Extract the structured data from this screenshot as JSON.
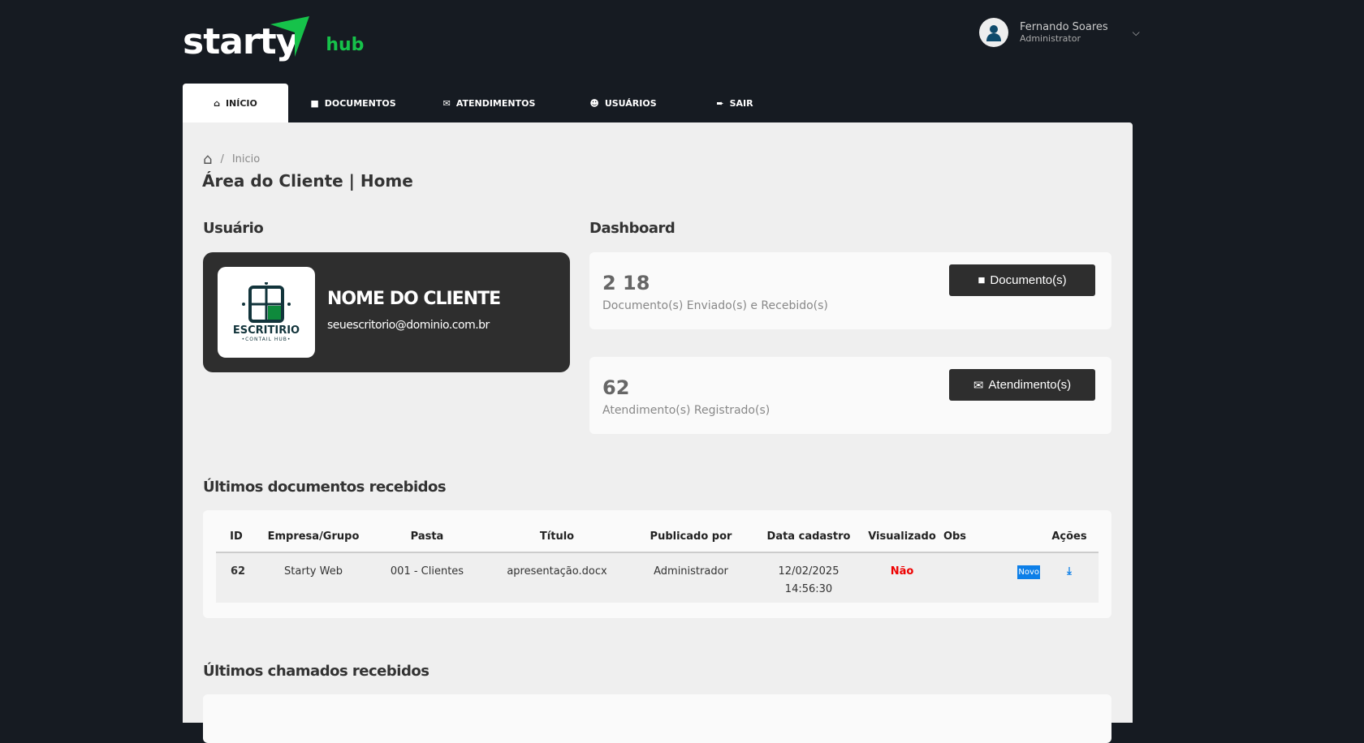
{
  "brand": {
    "logo_text": "starty",
    "logo_suffix": "hub"
  },
  "user": {
    "name": "Fernando Soares",
    "role": "Administrator"
  },
  "nav": [
    {
      "label": "INÍCIO",
      "icon": "home-icon"
    },
    {
      "label": "DOCUMENTOS",
      "icon": "folder-icon"
    },
    {
      "label": "ATENDIMENTOS",
      "icon": "envelope-icon"
    },
    {
      "label": "USUÁRIOS",
      "icon": "users-icon"
    },
    {
      "label": "SAIR",
      "icon": "sign-out-icon"
    }
  ],
  "breadcrumb": {
    "current": "Inicio"
  },
  "page_title": "Área do Cliente | Home",
  "usuario": {
    "heading": "Usuário",
    "client_name": "NOME DO CLIENTE",
    "email": "seuescritorio@dominio.com.br",
    "logo_title": "ESCRITIRIO",
    "logo_subtitle": "•CONTAIL HUB•"
  },
  "dashboard": {
    "heading": "Dashboard",
    "cards": [
      {
        "value": "2 18",
        "label": "Documento(s) Enviado(s) e Recebido(s)",
        "button": "Documento(s)"
      },
      {
        "value": "62",
        "label": "Atendimento(s) Registrado(s)",
        "button": "Atendimento(s)"
      }
    ]
  },
  "docs": {
    "heading": "Últimos documentos recebidos",
    "columns": [
      "ID",
      "Empresa/Grupo",
      "Pasta",
      "Título",
      "Publicado por",
      "Data cadastro",
      "Visualizado",
      "Obs",
      "",
      "Ações"
    ],
    "rows": [
      {
        "id": "62",
        "empresa": "Starty Web",
        "pasta": "001 - Clientes",
        "titulo": "apresentação.docx",
        "publicado": "Administrador",
        "data": "12/02/2025",
        "hora": "14:56:30",
        "visualizado": "Não",
        "badge": "Novo"
      }
    ]
  },
  "chamados": {
    "heading": "Últimos chamados recebidos"
  }
}
